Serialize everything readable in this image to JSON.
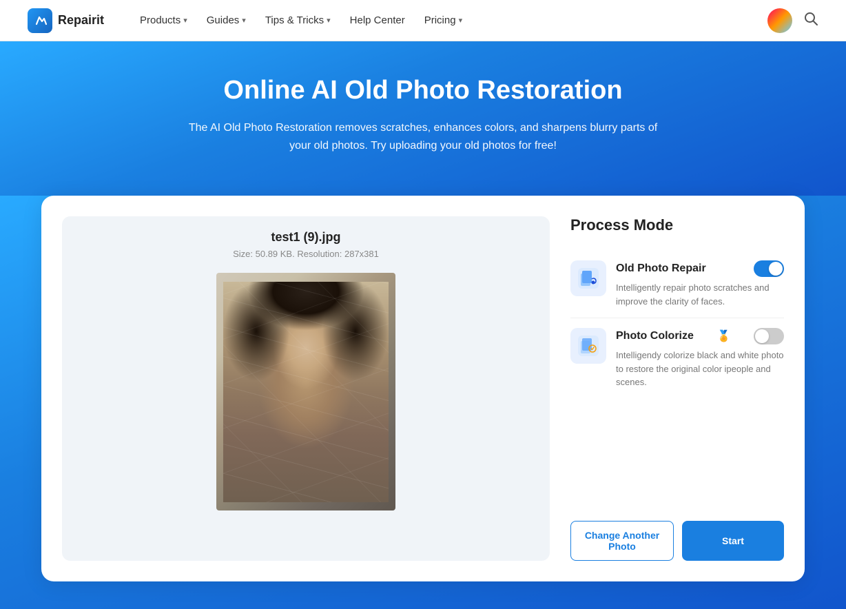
{
  "nav": {
    "logo_icon": "R",
    "logo_text": "Repairit",
    "items": [
      {
        "label": "Products",
        "has_chevron": true
      },
      {
        "label": "Guides",
        "has_chevron": true
      },
      {
        "label": "Tips & Tricks",
        "has_chevron": true
      },
      {
        "label": "Help Center",
        "has_chevron": false
      },
      {
        "label": "Pricing",
        "has_chevron": true
      }
    ]
  },
  "hero": {
    "title": "Online AI Old Photo Restoration",
    "subtitle": "The AI Old Photo Restoration removes scratches, enhances colors, and sharpens blurry parts of your old photos. Try uploading your old photos for free!"
  },
  "file": {
    "name": "test1 (9).jpg",
    "meta": "Size: 50.89 KB. Resolution: 287x381"
  },
  "process_mode": {
    "title": "Process Mode",
    "modes": [
      {
        "name": "Old Photo Repair",
        "desc": "Intelligently repair photo scratches and improve the clarity of faces.",
        "enabled": true,
        "badge": ""
      },
      {
        "name": "Photo Colorize",
        "desc": "Intelligendy colorize black and white photo to restore the original color ipeople and scenes.",
        "enabled": false,
        "badge": "🏅"
      }
    ]
  },
  "buttons": {
    "change": "Change Another Photo",
    "start": "Start"
  }
}
